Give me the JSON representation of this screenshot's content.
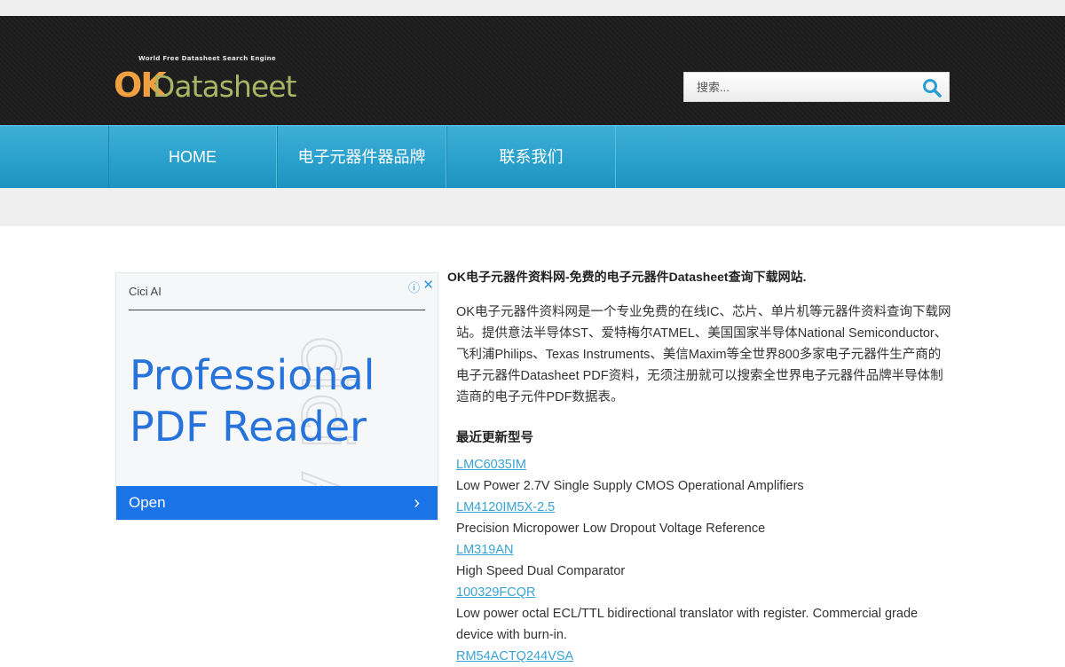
{
  "header": {
    "logo_tagline": "World Free Datasheet Search Engine",
    "logo_ok": "OK",
    "logo_datasheet": "Datasheet",
    "search_placeholder": "搜索..."
  },
  "nav": {
    "items": [
      {
        "label": "HOME"
      },
      {
        "label": "电子元器件器品牌"
      },
      {
        "label": "联系我们"
      }
    ]
  },
  "ad": {
    "brand": "Cici AI",
    "watermark": "cici AI",
    "headline_line1": "Professional",
    "headline_line2": "PDF Reader",
    "open_label": "Open"
  },
  "main": {
    "site_title": "OK电子元器件资料网-免费的电子元器件Datasheet查询下载网站.",
    "intro": "OK电子元器件资料网是一个专业免费的在线IC、芯片、单片机等元器件资料查询下载网站。提供意法半导体ST、爱特梅尔ATMEL、美国国家半导体National Semiconductor、飞利浦Philips、Texas Instruments、美信Maxim等全世界800多家电子元器件生产商的电子元器件Datasheet PDF资料，无须注册就可以搜索全世界电子元器件品牌半导体制造商的电子元件PDF数据表。",
    "recent_heading": "最近更新型号",
    "parts": [
      {
        "part": "LMC6035IM",
        "desc": "Low Power 2.7V Single Supply CMOS Operational Amplifiers"
      },
      {
        "part": "LM4120IM5X-2.5",
        "desc": "Precision Micropower Low Dropout Voltage Reference"
      },
      {
        "part": "LM319AN",
        "desc": "High Speed Dual Comparator"
      },
      {
        "part": "100329FCQR",
        "desc": "Low power octal ECL/TTL bidirectional translator with register. Commercial grade device with burn-in."
      },
      {
        "part": "RM54ACTQ244VSA",
        "desc": ""
      }
    ]
  },
  "colors": {
    "nav_blue": "#2aa0cc",
    "link": "#39a3d3",
    "ad_blue": "#1b73e8",
    "logo_orange": "#f0a040",
    "logo_olive": "#a9b565"
  }
}
